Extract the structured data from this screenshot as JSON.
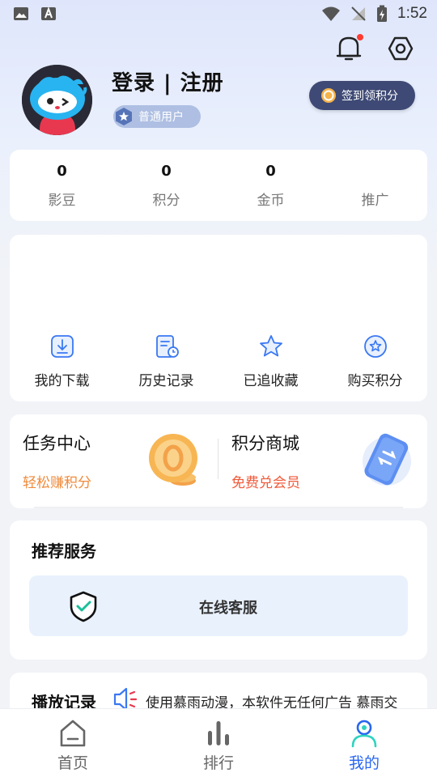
{
  "status_bar": {
    "time": "1:52"
  },
  "colors": {
    "accent": "#2866f0",
    "orange": "#f08a3a",
    "checkin_bg": "#3e4a75",
    "badge_bg": "#aebfe3"
  },
  "header": {
    "login_title": "登录 | 注册",
    "user_level": "普通用户",
    "checkin_label": "签到领积分",
    "icons": [
      "bell-icon",
      "settings-icon"
    ]
  },
  "stats": [
    {
      "value": "0",
      "label": "影豆"
    },
    {
      "value": "0",
      "label": "积分"
    },
    {
      "value": "0",
      "label": "金币"
    },
    {
      "value": "",
      "label": "推广"
    }
  ],
  "tools": [
    {
      "label": "我的下载",
      "icon": "download-icon"
    },
    {
      "label": "历史记录",
      "icon": "history-icon"
    },
    {
      "label": "已追收藏",
      "icon": "star-icon"
    },
    {
      "label": "购买积分",
      "icon": "buy-points-icon"
    }
  ],
  "promo": {
    "task": {
      "title": "任务中心",
      "subtitle": "轻松赚积分"
    },
    "mall": {
      "title": "积分商城",
      "subtitle": "免费兑会员"
    }
  },
  "services": {
    "title": "推荐服务",
    "items": [
      {
        "label": "在线客服",
        "icon": "shield-check-icon"
      }
    ]
  },
  "history": {
    "title": "播放记录",
    "marquee": "使用慕雨动漫，本软件无任何广告 慕雨交"
  },
  "bottom_nav": [
    {
      "label": "首页",
      "icon": "home-icon",
      "active": false
    },
    {
      "label": "排行",
      "icon": "ranking-icon",
      "active": false
    },
    {
      "label": "我的",
      "icon": "profile-icon",
      "active": true
    }
  ]
}
